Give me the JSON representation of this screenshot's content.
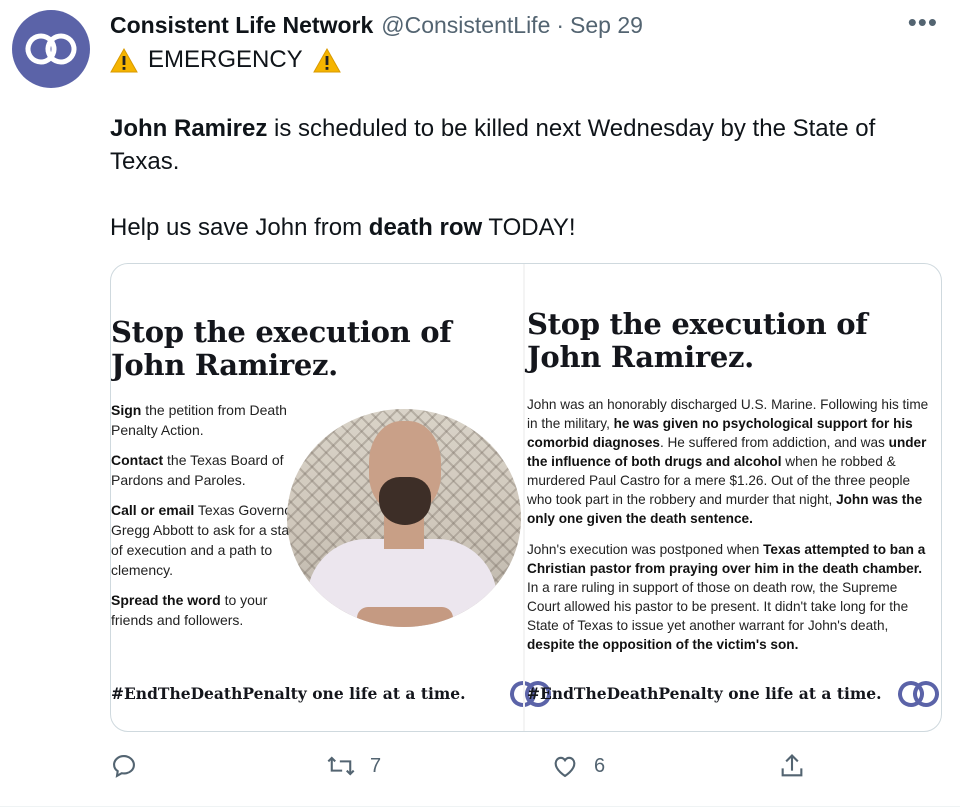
{
  "tweet": {
    "display_name": "Consistent Life Network",
    "handle": "@ConsistentLife",
    "separator": "·",
    "date": "Sep 29",
    "more_label": "•••",
    "emergency_prefix": "⚠️",
    "emergency_text": "EMERGENCY",
    "emergency_suffix": "⚠️",
    "p1_bold": "John Ramirez",
    "p1_rest": " is scheduled to be killed next Wednesday by the State of Texas.",
    "p2_start": "Help us save John from ",
    "p2_bold": "death row",
    "p2_end": " TODAY!"
  },
  "card": {
    "left": {
      "heading_line1": "Stop the execution of",
      "heading_line2": "John Ramirez.",
      "steps": [
        {
          "bold": "Sign",
          "rest": " the petition from Death Penalty Action."
        },
        {
          "bold": "Contact",
          "rest": " the Texas Board of Pardons and Paroles."
        },
        {
          "bold": "Call or email",
          "rest": " Texas Governor Gregg Abbott to ask for a stay of execution and a path to clemency."
        },
        {
          "bold": "Spread the word",
          "rest": " to your friends and followers."
        }
      ],
      "tagline": "#EndTheDeathPenalty one life at a time."
    },
    "right": {
      "heading_line1": "Stop the execution of",
      "heading_line2": "John Ramirez.",
      "para1": {
        "a": "John was an honorably discharged U.S. Marine. Following his time in the military, ",
        "b": "he was given no psychological support for his comorbid diagnoses",
        "c": ". He suffered from addiction, and was ",
        "d": "under the influence of both drugs and alcohol",
        "e": " when he robbed & murdered Paul Castro for a mere $1.26. Out of the three people who took part in the robbery and murder that night, ",
        "f": "John was the only one given the death sentence."
      },
      "para2": {
        "a": "John's execution was postponed when ",
        "b": "Texas attempted to ban a Christian pastor from praying over him in the death chamber.",
        "c": " In a rare ruling in support of those on death row, the Supreme Court allowed his pastor to be present. It didn't take long for the State of Texas to issue yet another warrant for John's death, ",
        "d": "despite the opposition of the victim's son."
      },
      "tagline": "#EndTheDeathPenalty one life at a time."
    }
  },
  "actions": {
    "reply_count": "",
    "retweet_count": "7",
    "like_count": "6"
  },
  "colors": {
    "brand": "#5b63a8",
    "muted": "#536471",
    "warning": "#f5b400"
  },
  "icons": [
    "logo-icon",
    "more-icon",
    "warning-icon",
    "reply-icon",
    "retweet-icon",
    "like-icon",
    "share-icon"
  ]
}
